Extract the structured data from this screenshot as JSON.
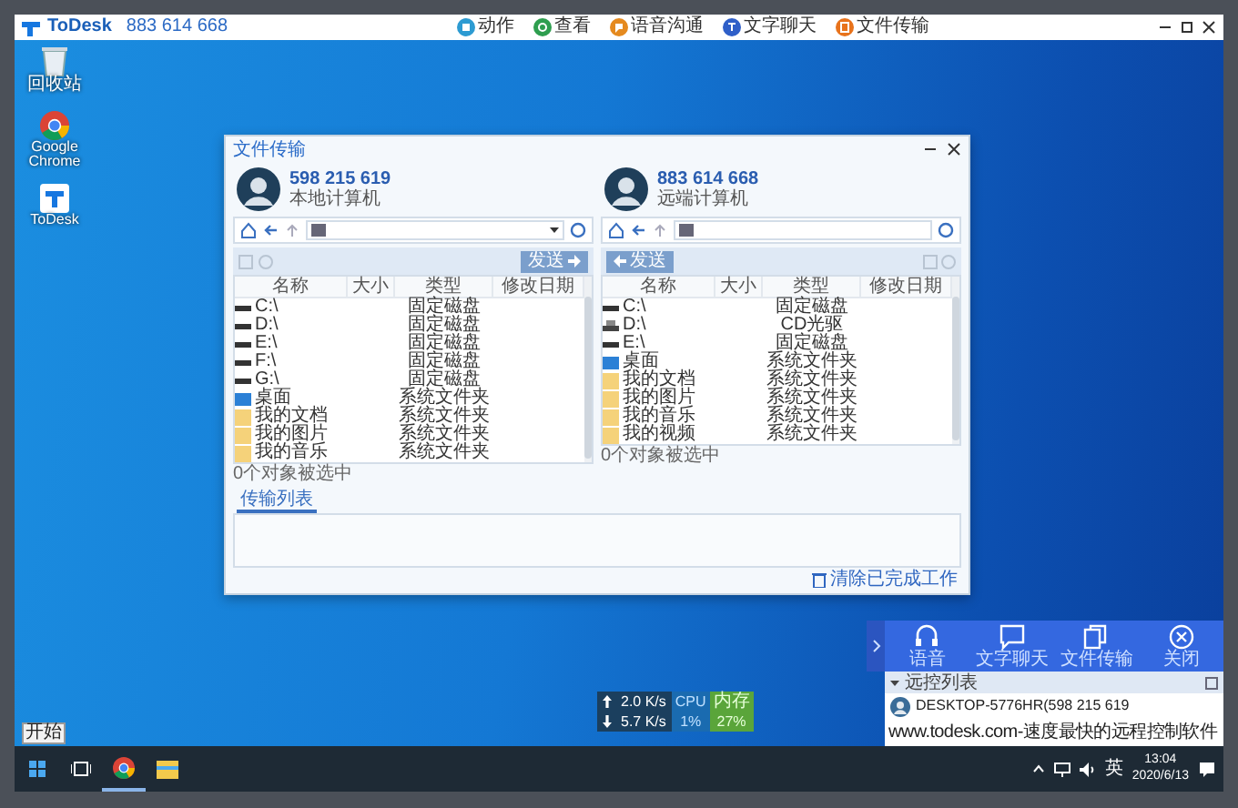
{
  "top_bar": {
    "app_name": "ToDesk",
    "device_id": "883 614 668",
    "menu": [
      {
        "label": "动作",
        "kind": "action",
        "color": "#2d9bd2"
      },
      {
        "label": "查看",
        "kind": "view",
        "color": "#2e9e4f"
      },
      {
        "label": "语音沟通",
        "kind": "voice",
        "color": "#e58a1f"
      },
      {
        "label": "文字聊天",
        "kind": "chat",
        "color": "#2f5fc8"
      },
      {
        "label": "文件传输",
        "kind": "file",
        "color": "#e8731c"
      }
    ]
  },
  "desktop_icons": [
    {
      "label": "回收站",
      "kind": "recycle"
    },
    {
      "label": "Google Chrome",
      "kind": "chrome"
    },
    {
      "label": "ToDesk",
      "kind": "todesk"
    }
  ],
  "file_transfer": {
    "title": "文件传输",
    "panes": [
      {
        "kind": "local",
        "id_number": "598 215 619",
        "role": "本地计算机",
        "send_button": "发送",
        "columns": [
          "名称",
          "大小",
          "类型",
          "修改日期"
        ],
        "rows": [
          {
            "name": "C:\\",
            "type": "固定磁盘",
            "kind": "drive"
          },
          {
            "name": "D:\\",
            "type": "固定磁盘",
            "kind": "drive"
          },
          {
            "name": "E:\\",
            "type": "固定磁盘",
            "kind": "drive"
          },
          {
            "name": "F:\\",
            "type": "固定磁盘",
            "kind": "drive"
          },
          {
            "name": "G:\\",
            "type": "固定磁盘",
            "kind": "drive"
          },
          {
            "name": "桌面",
            "type": "系统文件夹",
            "kind": "desktop"
          },
          {
            "name": "我的文档",
            "type": "系统文件夹",
            "kind": "folder"
          },
          {
            "name": "我的图片",
            "type": "系统文件夹",
            "kind": "folder"
          },
          {
            "name": "我的音乐",
            "type": "系统文件夹",
            "kind": "folder"
          }
        ],
        "status": "0个对象被选中"
      },
      {
        "kind": "remote",
        "id_number": "883 614 668",
        "role": "远端计算机",
        "send_button": "发送",
        "columns": [
          "名称",
          "大小",
          "类型",
          "修改日期"
        ],
        "rows": [
          {
            "name": "C:\\",
            "type": "固定磁盘",
            "kind": "drive"
          },
          {
            "name": "D:\\",
            "type": "CD光驱",
            "kind": "cdrom"
          },
          {
            "name": "E:\\",
            "type": "固定磁盘",
            "kind": "drive"
          },
          {
            "name": "桌面",
            "type": "系统文件夹",
            "kind": "desktop"
          },
          {
            "name": "我的文档",
            "type": "系统文件夹",
            "kind": "folder"
          },
          {
            "name": "我的图片",
            "type": "系统文件夹",
            "kind": "folder"
          },
          {
            "name": "我的音乐",
            "type": "系统文件夹",
            "kind": "folder"
          },
          {
            "name": "我的视频",
            "type": "系统文件夹",
            "kind": "folder"
          }
        ],
        "status": "0个对象被选中"
      }
    ],
    "tabs": [
      {
        "label": "传输列表",
        "selected": true
      }
    ],
    "clear_button": "清除已完成工作"
  },
  "remote_panel": {
    "actions": [
      {
        "label": "语音",
        "kind": "headset"
      },
      {
        "label": "文字聊天",
        "kind": "chat"
      },
      {
        "label": "文件传输",
        "kind": "files"
      },
      {
        "label": "关闭",
        "kind": "close"
      }
    ],
    "list_title": "远控列表",
    "expanded": true,
    "entries": [
      "DESKTOP-5776HR(598 215 619"
    ],
    "footer": "www.todesk.com-速度最快的远程控制软件"
  },
  "net_meter": {
    "upload": "2.0 K/s",
    "download": "5.7 K/s",
    "cpu_label": "CPU",
    "cpu": "1%",
    "mem_label": "内存",
    "mem": "27%"
  },
  "taskbar": {
    "start_tooltip": "开始",
    "apps": [
      {
        "kind": "taskview",
        "running": false
      },
      {
        "kind": "chrome",
        "running": true
      },
      {
        "kind": "explorer",
        "running": false
      }
    ],
    "ime": "英",
    "time": "13:04",
    "date": "2020/6/13"
  }
}
